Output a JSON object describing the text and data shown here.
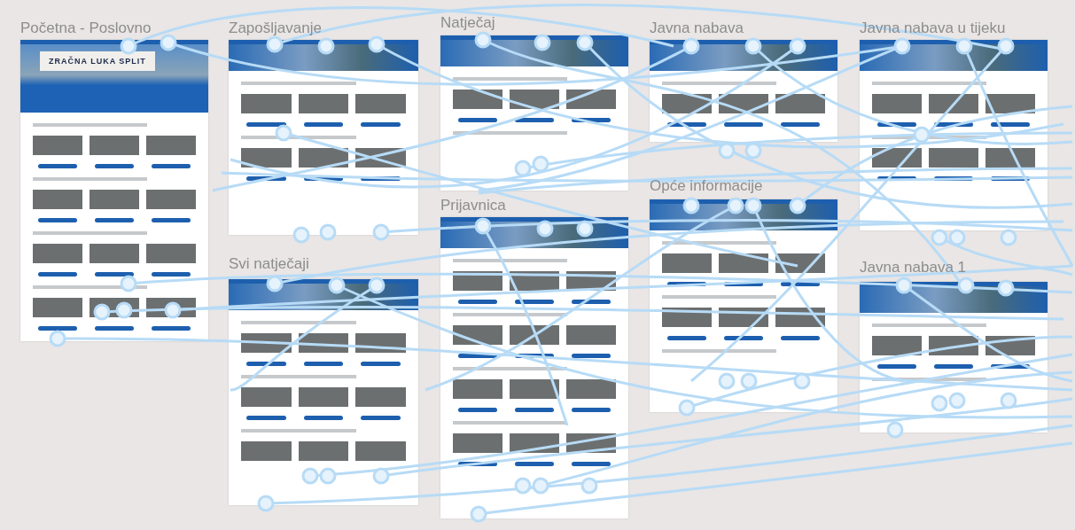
{
  "artboards": [
    {
      "title": "Početna - Poslovno",
      "hero_title": "ZRAČNA LUKA SPLIT"
    },
    {
      "title": "Zapošljavanje"
    },
    {
      "title": "Svi natječaji"
    },
    {
      "title": "Natječaj"
    },
    {
      "title": "Prijavnica"
    },
    {
      "title": "Javna nabava"
    },
    {
      "title": "Opće informacije"
    },
    {
      "title": "Javna nabava u tijeku"
    },
    {
      "title": "Javna nabava 1"
    }
  ]
}
